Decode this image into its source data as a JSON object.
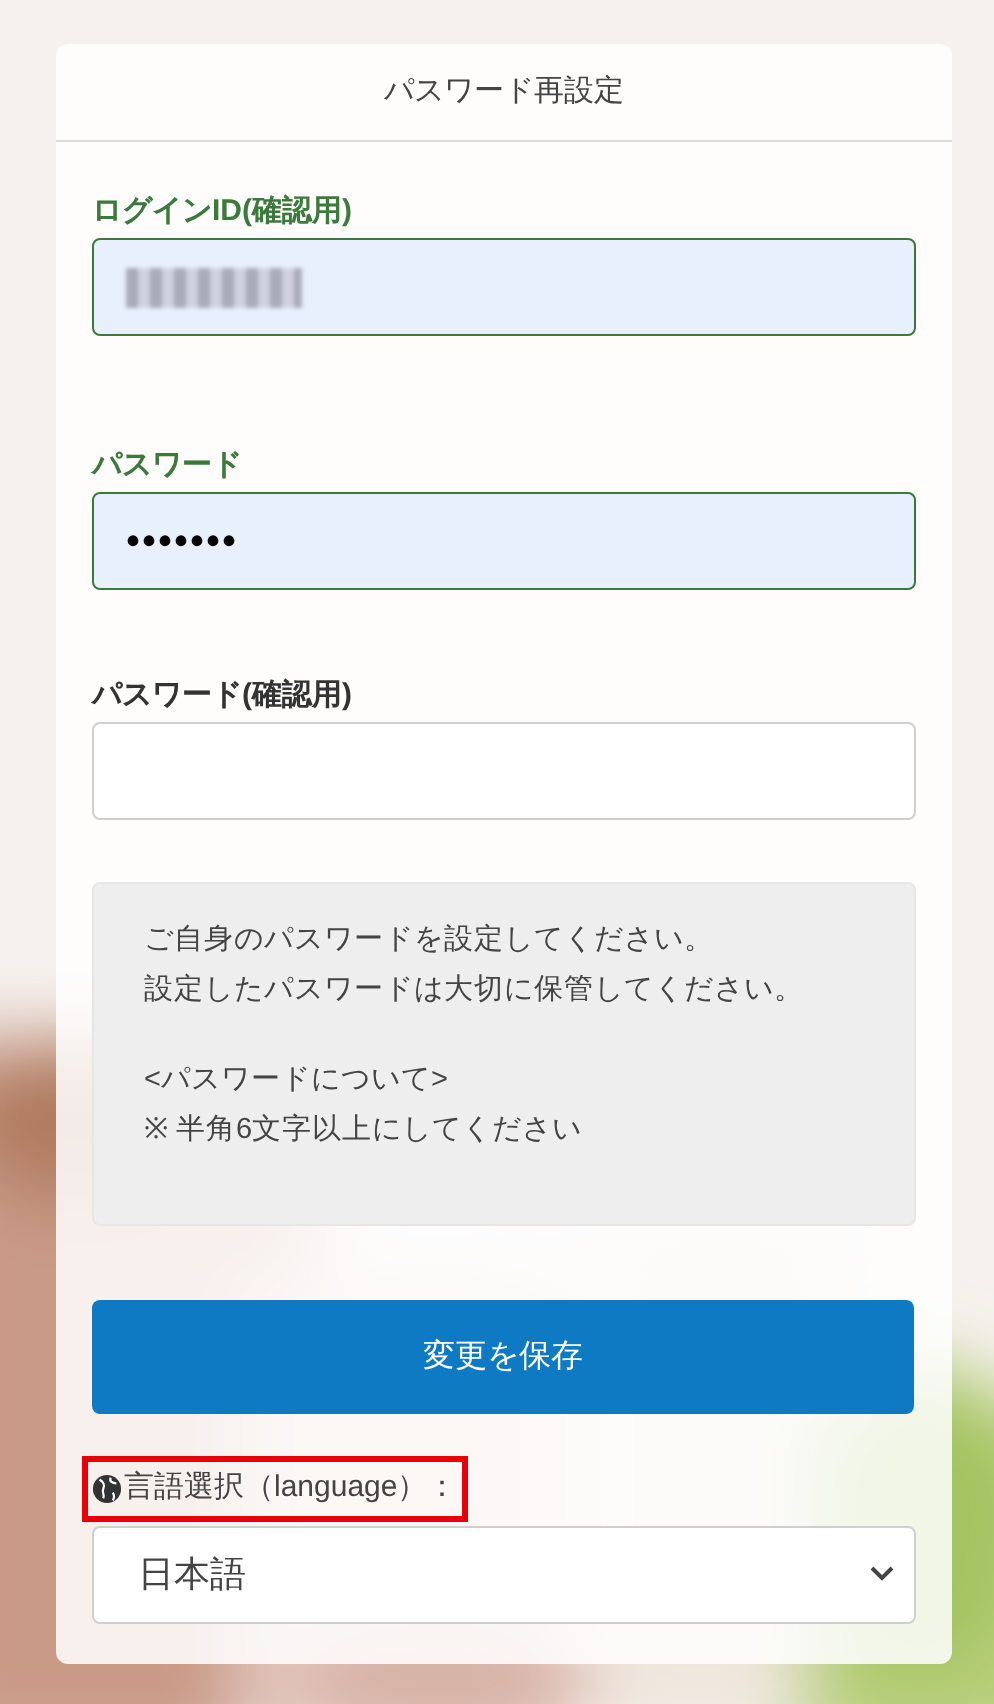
{
  "card": {
    "title": "パスワード再設定"
  },
  "fields": [
    {
      "label": "ログインID(確認用)",
      "autofilled": true,
      "redacted": true
    },
    {
      "label": "パスワード",
      "autofilled": true,
      "value": "•••••••"
    },
    {
      "label": "パスワード(確認用)",
      "autofilled": false
    }
  ],
  "notice": [
    [
      "ご自身のパスワードを設定してください。",
      "設定したパスワードは大切に保管してください。"
    ],
    [
      "<パスワードについて>",
      "※ 半角6文字以上にしてください"
    ]
  ],
  "save_button": "変更を保存",
  "language": {
    "label": "言語選択（language）：",
    "highlighted": true,
    "value": "日本語"
  }
}
